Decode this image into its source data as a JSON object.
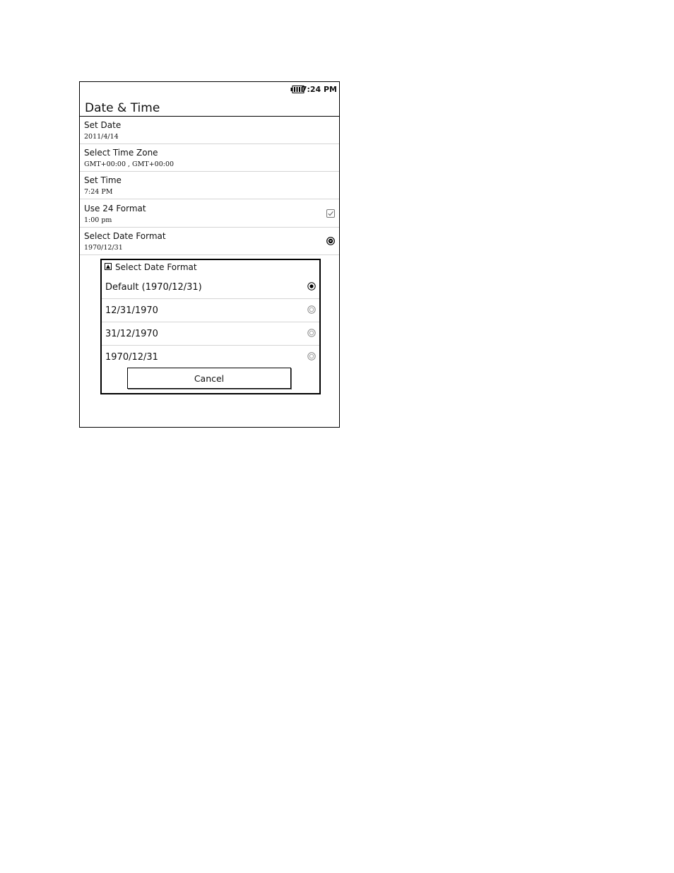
{
  "status_bar": {
    "time": "7:24 PM",
    "battery_icon": "battery-icon"
  },
  "header": {
    "title": "Date & Time"
  },
  "settings": [
    {
      "label": "Set Date",
      "value": "2011/4/14",
      "control": null
    },
    {
      "label": "Select Time Zone",
      "value": "GMT+00:00 , GMT+00:00",
      "control": null
    },
    {
      "label": "Set Time",
      "value": "7:24 PM",
      "control": null
    },
    {
      "label": "Use 24 Format",
      "value": "1:00 pm",
      "control": "checkbox",
      "checked": true
    },
    {
      "label": "Select Date Format",
      "value": "1970/12/31",
      "control": "dropdown-icon"
    }
  ],
  "dialog": {
    "title": "Select Date Format",
    "title_icon": "dialog-icon",
    "options": [
      {
        "label": "Default  (1970/12/31)",
        "selected": true
      },
      {
        "label": "12/31/1970",
        "selected": false
      },
      {
        "label": "31/12/1970",
        "selected": false
      },
      {
        "label": "1970/12/31",
        "selected": false
      }
    ],
    "cancel_label": "Cancel"
  }
}
